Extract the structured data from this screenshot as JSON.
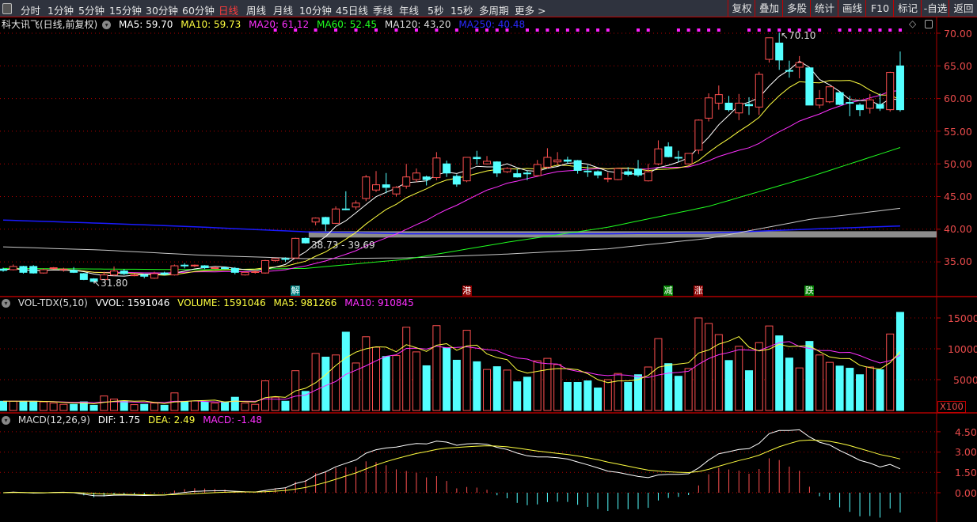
{
  "toolbar": {
    "periods": [
      "分时",
      "1分钟",
      "5分钟",
      "15分钟",
      "30分钟",
      "60分钟",
      "日线",
      "周线",
      "月线",
      "10分钟",
      "45日线",
      "季线",
      "年线",
      "5秒",
      "15秒",
      "多周期",
      "更多 >"
    ],
    "active_period": "日线",
    "right_buttons": [
      "复权",
      "叠加",
      "多股",
      "统计",
      "画线",
      "F10",
      "标记",
      "-自选",
      "返回"
    ]
  },
  "price_header": {
    "title": "科大讯飞(日线,前复权)",
    "ma5": "MA5: 59.70",
    "ma10": "MA10: 59.73",
    "ma20": "MA20: 61.12",
    "ma60": "MA60: 52.45",
    "ma120": "MA120: 43.20",
    "ma250": "MA250: 40.48"
  },
  "vol_header": {
    "name": "VOL-TDX(5,10)",
    "vvol": "VVOL: 1591046",
    "volume": "VOLUME: 1591046",
    "ma5": "MA5: 981266",
    "ma10": "MA10: 910845"
  },
  "macd_header": {
    "name": "MACD(12,26,9)",
    "dif": "DIF: 1.75",
    "dea": "DEA: 2.49",
    "macd": "MACD: -1.48"
  },
  "annotations": {
    "high_label": "70.10",
    "low_label": "31.80",
    "gap_label": "38.73 - 39.69"
  },
  "markers": [
    {
      "index": 29,
      "text": "解",
      "color": "#008080"
    },
    {
      "index": 46,
      "text": "港",
      "color": "#8b0000"
    },
    {
      "index": 66,
      "text": "减",
      "color": "#008000"
    },
    {
      "index": 69,
      "text": "涨",
      "color": "#8b0000"
    },
    {
      "index": 80,
      "text": "跌",
      "color": "#008000"
    }
  ],
  "colors": {
    "up": "#ff5050",
    "down": "#54ffff",
    "ma5": "#ffffff",
    "ma10": "#ffff40",
    "ma20": "#ff30ff",
    "ma60": "#20ff20",
    "ma120": "#c8c8c8",
    "ma250": "#1a1aff",
    "axis": "#e84a4a",
    "grid": "#b00000"
  },
  "chart_data": [
    {
      "type": "candlestick",
      "title": "科大讯飞(日线,前复权)",
      "ylim": [
        31,
        72
      ],
      "yticks": [
        "70.00",
        "65.00",
        "60.00",
        "55.00",
        "50.00",
        "45.00",
        "40.00",
        "35.00"
      ],
      "ohlc": [
        [
          33.9,
          34.1,
          33.5,
          33.7
        ],
        [
          33.8,
          34.6,
          33.7,
          34.3
        ],
        [
          34.3,
          34.4,
          33.2,
          33.4
        ],
        [
          34.3,
          34.5,
          33.2,
          33.3
        ],
        [
          33.3,
          34.0,
          33.2,
          33.8
        ],
        [
          34.0,
          34.2,
          33.8,
          34.1
        ],
        [
          33.9,
          34.1,
          33.5,
          33.9
        ],
        [
          33.7,
          34.2,
          33.3,
          33.4
        ],
        [
          33.2,
          33.3,
          32.2,
          32.3
        ],
        [
          32.4,
          32.5,
          31.8,
          32.0
        ],
        [
          32.3,
          33.5,
          32.2,
          33.0
        ],
        [
          33.0,
          34.3,
          32.8,
          33.6
        ],
        [
          33.6,
          33.9,
          33.0,
          33.2
        ],
        [
          33.0,
          33.2,
          32.8,
          33.0
        ],
        [
          33.0,
          33.2,
          32.5,
          32.8
        ],
        [
          32.5,
          33.5,
          32.4,
          33.2
        ],
        [
          33.3,
          33.5,
          32.9,
          33.1
        ],
        [
          33.0,
          34.6,
          32.9,
          34.4
        ],
        [
          34.5,
          34.8,
          34.0,
          34.4
        ],
        [
          34.4,
          34.6,
          34.2,
          34.5
        ],
        [
          34.4,
          34.5,
          33.9,
          34.1
        ],
        [
          34.1,
          34.3,
          33.9,
          34.1
        ],
        [
          34.1,
          34.3,
          33.9,
          34.0
        ],
        [
          34.0,
          34.2,
          33.1,
          33.4
        ],
        [
          33.0,
          33.5,
          32.9,
          33.4
        ],
        [
          33.5,
          33.7,
          33.2,
          33.5
        ],
        [
          33.3,
          35.3,
          33.2,
          35.2
        ],
        [
          35.2,
          35.6,
          35.0,
          35.5
        ],
        [
          35.5,
          35.7,
          35.0,
          35.4
        ],
        [
          35.6,
          38.7,
          35.5,
          38.6
        ],
        [
          38.6,
          38.73,
          37.8,
          37.9
        ],
        [
          41.1,
          41.8,
          40.6,
          41.7
        ],
        [
          41.8,
          41.9,
          39.69,
          40.8
        ],
        [
          40.9,
          43.5,
          40.8,
          43.1
        ],
        [
          43.1,
          45.8,
          42.9,
          43.0
        ],
        [
          43.4,
          44.4,
          43.0,
          44.0
        ],
        [
          44.7,
          48.3,
          44.3,
          48.0
        ],
        [
          46.0,
          48.9,
          45.7,
          46.8
        ],
        [
          46.8,
          48.6,
          45.5,
          46.4
        ],
        [
          45.4,
          46.6,
          45.0,
          46.4
        ],
        [
          46.6,
          50.0,
          46.2,
          48.0
        ],
        [
          47.6,
          49.3,
          47.2,
          48.6
        ],
        [
          48.0,
          48.2,
          46.7,
          47.6
        ],
        [
          47.9,
          51.8,
          47.5,
          50.9
        ],
        [
          50.0,
          50.5,
          48.0,
          48.6
        ],
        [
          48.1,
          48.4,
          46.5,
          46.9
        ],
        [
          47.4,
          51.0,
          47.2,
          51.0
        ],
        [
          51.0,
          52.0,
          49.9,
          50.8
        ],
        [
          50.0,
          51.2,
          49.9,
          50.4
        ],
        [
          50.3,
          50.4,
          48.0,
          48.6
        ],
        [
          48.8,
          49.5,
          48.6,
          49.3
        ],
        [
          48.5,
          49.2,
          47.9,
          48.0
        ],
        [
          48.6,
          49.0,
          47.5,
          48.5
        ],
        [
          48.2,
          50.6,
          48.1,
          49.9
        ],
        [
          49.5,
          52.4,
          49.3,
          51.0
        ],
        [
          50.3,
          51.8,
          49.9,
          50.6
        ],
        [
          50.6,
          51.1,
          50.0,
          50.4
        ],
        [
          50.5,
          50.6,
          48.5,
          49.0
        ],
        [
          48.9,
          49.8,
          48.0,
          48.8
        ],
        [
          48.8,
          49.0,
          47.8,
          48.3
        ],
        [
          47.7,
          48.7,
          47.2,
          47.8
        ],
        [
          47.6,
          49.4,
          47.5,
          49.3
        ],
        [
          48.8,
          49.5,
          48.1,
          48.4
        ],
        [
          49.2,
          50.6,
          48.0,
          48.3
        ],
        [
          47.4,
          50.0,
          47.3,
          48.8
        ],
        [
          50.0,
          53.6,
          49.8,
          52.3
        ],
        [
          52.6,
          53.3,
          51.0,
          51.1
        ],
        [
          51.0,
          52.0,
          50.3,
          50.9
        ],
        [
          50.0,
          51.6,
          49.9,
          51.6
        ],
        [
          52.1,
          56.8,
          51.5,
          56.7
        ],
        [
          57.0,
          60.8,
          56.5,
          60.1
        ],
        [
          59.3,
          62.0,
          58.3,
          60.6
        ],
        [
          59.3,
          60.4,
          58.0,
          58.3
        ],
        [
          57.8,
          60.7,
          56.7,
          59.3
        ],
        [
          59.1,
          60.2,
          57.5,
          58.9
        ],
        [
          58.7,
          64.1,
          57.5,
          63.7
        ],
        [
          66.0,
          69.3,
          65.5,
          69.3
        ],
        [
          68.5,
          70.1,
          64.4,
          65.9
        ],
        [
          64.3,
          65.8,
          63.2,
          64.2
        ],
        [
          64.8,
          66.5,
          63.1,
          65.5
        ],
        [
          64.7,
          64.7,
          59.0,
          59.0
        ],
        [
          59.0,
          61.3,
          58.5,
          60.0
        ],
        [
          59.5,
          61.8,
          59.3,
          61.8
        ],
        [
          60.9,
          61.0,
          59.0,
          59.1
        ],
        [
          59.4,
          60.4,
          57.3,
          59.3
        ],
        [
          59.0,
          59.3,
          57.3,
          58.3
        ],
        [
          58.5,
          60.7,
          57.7,
          59.8
        ],
        [
          59.1,
          60.8,
          58.1,
          58.5
        ],
        [
          58.3,
          64.1,
          58.0,
          64.0
        ],
        [
          65.0,
          67.2,
          58.0,
          58.3
        ]
      ],
      "ma60_sparse": {
        "index": [
          0,
          10,
          20,
          30,
          40,
          50,
          60,
          70,
          80,
          89
        ],
        "values": [
          34.0,
          33.9,
          33.8,
          34.0,
          35.4,
          38.0,
          40.3,
          43.5,
          48.0,
          52.5
        ]
      },
      "ma120_sparse": {
        "index": [
          0,
          10,
          20,
          30,
          40,
          50,
          60,
          70,
          80,
          89
        ],
        "values": [
          37.3,
          36.8,
          36.0,
          35.5,
          35.6,
          36.2,
          37.0,
          38.6,
          41.5,
          43.2
        ]
      },
      "ma250_sparse": {
        "index": [
          0,
          10,
          20,
          30,
          40,
          50,
          60,
          70,
          80,
          89
        ],
        "values": [
          41.4,
          40.9,
          40.3,
          39.6,
          39.3,
          39.3,
          39.3,
          39.4,
          40.0,
          40.5
        ]
      },
      "gap": {
        "from_index": 30,
        "low": 38.73,
        "high": 39.69
      },
      "signal_dots_index": [
        27,
        29,
        31,
        33,
        35,
        37,
        39,
        41,
        43,
        45,
        47,
        48,
        49,
        50,
        52,
        53,
        54,
        55,
        56,
        57,
        58,
        59,
        60,
        63,
        64,
        67,
        68,
        69,
        70,
        71,
        74,
        75,
        76,
        77,
        78,
        79,
        80,
        81,
        83,
        84,
        85,
        86,
        87,
        88,
        89
      ]
    },
    {
      "type": "bar",
      "title": "VOL-TDX(5,10)",
      "unit": "X100",
      "ylim": [
        0,
        16500
      ],
      "yticks": [
        "15000",
        "10000",
        "5000"
      ],
      "values": [
        1500,
        1500,
        1500,
        1500,
        1400,
        1200,
        1000,
        1000,
        1400,
        850,
        2350,
        1850,
        1550,
        950,
        1000,
        1200,
        850,
        2850,
        1400,
        1550,
        1400,
        1200,
        1300,
        2150,
        1200,
        1000,
        4800,
        2150,
        1500,
        6450,
        3100,
        9250,
        8650,
        9000,
        12700,
        7700,
        11950,
        10250,
        8750,
        8900,
        13500,
        9500,
        7250,
        13750,
        10150,
        8150,
        13000,
        7900,
        6650,
        7100,
        6550,
        4650,
        5400,
        8050,
        8450,
        7450,
        4550,
        4550,
        4800,
        3650,
        5000,
        6000,
        4550,
        5800,
        7050,
        11650,
        7600,
        5550,
        6800,
        15000,
        14100,
        12300,
        8100,
        10400,
        6450,
        11000,
        13700,
        12100,
        8500,
        6900,
        11200,
        9000,
        7800,
        7200,
        6850,
        5800,
        7050,
        6600,
        12400,
        15910
      ]
    },
    {
      "type": "line",
      "title": "MACD(12,26,9)",
      "ylim": [
        -2.2,
        5.8
      ],
      "yticks": [
        "4.50",
        "3.00",
        "1.50",
        "0.00"
      ]
    }
  ]
}
